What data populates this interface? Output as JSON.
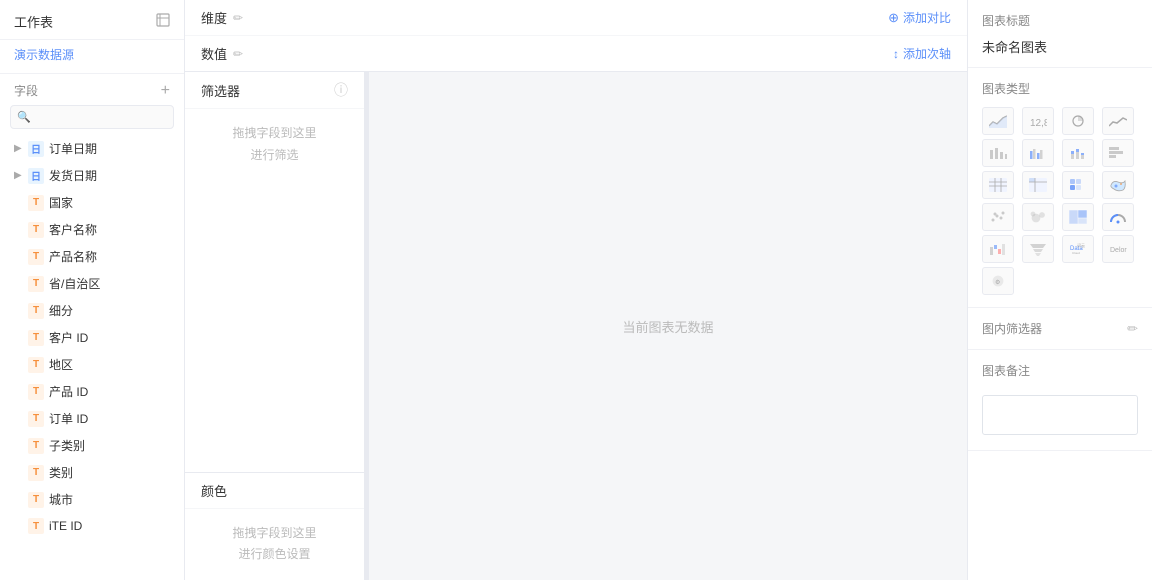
{
  "leftPanel": {
    "title": "工作表",
    "demoSource": "演示数据源",
    "fieldsLabel": "字段",
    "searchPlaceholder": "",
    "fields": [
      {
        "id": "order-date",
        "type": "date",
        "name": "订单日期",
        "expandable": true
      },
      {
        "id": "ship-date",
        "type": "date",
        "name": "发货日期",
        "expandable": true
      },
      {
        "id": "country",
        "type": "text",
        "name": "国家",
        "expandable": false
      },
      {
        "id": "customer-name",
        "type": "text",
        "name": "客户名称",
        "expandable": false
      },
      {
        "id": "product-name",
        "type": "text",
        "name": "产品名称",
        "expandable": false
      },
      {
        "id": "province",
        "type": "text",
        "name": "省/自治区",
        "expandable": false
      },
      {
        "id": "segment",
        "type": "text",
        "name": "细分",
        "expandable": false
      },
      {
        "id": "customer-id",
        "type": "text",
        "name": "客户 ID",
        "expandable": false
      },
      {
        "id": "region",
        "type": "text",
        "name": "地区",
        "expandable": false
      },
      {
        "id": "product-id",
        "type": "text",
        "name": "产品 ID",
        "expandable": false
      },
      {
        "id": "order-id",
        "type": "text",
        "name": "订单 ID",
        "expandable": false
      },
      {
        "id": "subcategory",
        "type": "text",
        "name": "子类别",
        "expandable": false
      },
      {
        "id": "category",
        "type": "text",
        "name": "类别",
        "expandable": false
      },
      {
        "id": "city",
        "type": "text",
        "name": "城市",
        "expandable": false
      },
      {
        "id": "site-id",
        "type": "text",
        "name": "iTE ID",
        "expandable": false
      }
    ]
  },
  "middlePanel": {
    "dimension": {
      "label": "维度",
      "action": "添加对比",
      "actionIcon": "+"
    },
    "value": {
      "label": "数值",
      "action": "添加次轴",
      "actionIcon": "+"
    },
    "filter": {
      "label": "筛选器",
      "dropHint1": "拖拽字段到这里",
      "dropHint2": "进行筛选"
    },
    "color": {
      "label": "颜色",
      "dropHint1": "拖拽字段到这里",
      "dropHint2": "进行颜色设置"
    },
    "chartEmpty": "当前图表无数据"
  },
  "rightPanel": {
    "chartTitle": {
      "sectionLabel": "图表标题",
      "value": "未命名图表"
    },
    "chartType": {
      "sectionLabel": "图表类型"
    },
    "inChartFilter": {
      "sectionLabel": "图内筛选器"
    },
    "annotation": {
      "sectionLabel": "图表备注",
      "placeholder": ""
    }
  }
}
